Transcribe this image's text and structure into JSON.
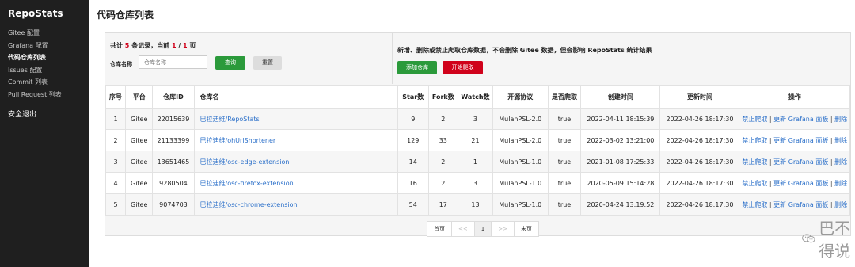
{
  "sidebar": {
    "brand": "RepoStats",
    "items": [
      {
        "label": "Gitee 配置"
      },
      {
        "label": "Grafana 配置"
      },
      {
        "label": "代码仓库列表"
      },
      {
        "label": "Issues 配置"
      },
      {
        "label": "Commit 列表"
      },
      {
        "label": "Pull Request 列表"
      }
    ],
    "active_index": 2,
    "logout": "安全退出"
  },
  "page": {
    "title": "代码仓库列表"
  },
  "summary": {
    "prefix": "共计 ",
    "total": "5",
    "middle": " 条记录，当前 ",
    "current": "1",
    "slash": " / ",
    "pages": "1",
    "suffix": " 页"
  },
  "search": {
    "label": "仓库名称",
    "placeholder": "仓库名称",
    "search_btn": "查询",
    "reset_btn": "重置"
  },
  "actions": {
    "notice": "新增、删除或禁止爬取仓库数据，不会删除 Gitee 数据，但会影响 RepoStats 统计结果",
    "add_btn": "添加仓库",
    "crawl_btn": "开始爬取"
  },
  "table": {
    "headers": [
      "序号",
      "平台",
      "仓库ID",
      "仓库名",
      "Star数",
      "Fork数",
      "Watch数",
      "开源协议",
      "是否爬取",
      "创建时间",
      "更新时间",
      "操作"
    ],
    "rows": [
      {
        "no": "1",
        "platform": "Gitee",
        "id": "22015639",
        "name": "巴拉迪维/RepoStats",
        "star": "9",
        "fork": "2",
        "watch": "3",
        "license": "MulanPSL-2.0",
        "crawl": "true",
        "created": "2022-04-11 18:15:39",
        "updated": "2022-04-26 18:17:30"
      },
      {
        "no": "2",
        "platform": "Gitee",
        "id": "21133399",
        "name": "巴拉迪维/ohUrlShortener",
        "star": "129",
        "fork": "33",
        "watch": "21",
        "license": "MulanPSL-2.0",
        "crawl": "true",
        "created": "2022-03-02 13:21:00",
        "updated": "2022-04-26 18:17:30"
      },
      {
        "no": "3",
        "platform": "Gitee",
        "id": "13651465",
        "name": "巴拉迪维/osc-edge-extension",
        "star": "14",
        "fork": "2",
        "watch": "1",
        "license": "MulanPSL-1.0",
        "crawl": "true",
        "created": "2021-01-08 17:25:33",
        "updated": "2022-04-26 18:17:30"
      },
      {
        "no": "4",
        "platform": "Gitee",
        "id": "9280504",
        "name": "巴拉迪维/osc-firefox-extension",
        "star": "16",
        "fork": "2",
        "watch": "3",
        "license": "MulanPSL-1.0",
        "crawl": "true",
        "created": "2020-05-09 15:14:28",
        "updated": "2022-04-26 18:17:30"
      },
      {
        "no": "5",
        "platform": "Gitee",
        "id": "9074703",
        "name": "巴拉迪维/osc-chrome-extension",
        "star": "54",
        "fork": "17",
        "watch": "13",
        "license": "MulanPSL-1.0",
        "crawl": "true",
        "created": "2020-04-24 13:19:52",
        "updated": "2022-04-26 18:17:30"
      }
    ],
    "row_actions": {
      "stop": "禁止爬取",
      "update": "更新 Grafana 面板",
      "delete": "删除",
      "sep": " | "
    }
  },
  "pagination": {
    "first": "首页",
    "prev": "<<",
    "page": "1",
    "next": ">>",
    "last": "末页"
  },
  "watermark": {
    "text": "巴不得说"
  },
  "colors": {
    "sidebar_bg": "#1f1f1f",
    "primary": "#2b9a3b",
    "danger": "#d0021b",
    "link": "#2a6fc9"
  }
}
